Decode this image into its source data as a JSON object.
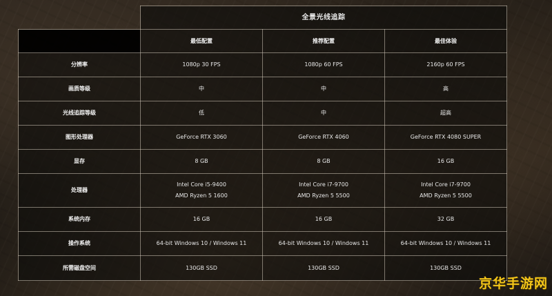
{
  "title": "全景光线追踪",
  "columns": [
    "最低配置",
    "推荐配置",
    "最佳体验"
  ],
  "rows": [
    {
      "label": "分辨率",
      "values": [
        "1080p 30 FPS",
        "1080p 60 FPS",
        "2160p 60 FPS"
      ]
    },
    {
      "label": "画质等级",
      "values": [
        "中",
        "中",
        "高"
      ]
    },
    {
      "label": "光线追踪等级",
      "values": [
        "低",
        "中",
        "超高"
      ]
    },
    {
      "label": "图形处理器",
      "values": [
        "GeForce RTX 3060",
        "GeForce RTX 4060",
        "GeForce RTX 4080 SUPER"
      ]
    },
    {
      "label": "显存",
      "values": [
        "8 GB",
        "8 GB",
        "16 GB"
      ]
    },
    {
      "label": "处理器",
      "values": [
        [
          "Intel Core i5-9400",
          "AMD Ryzen 5 1600"
        ],
        [
          "Intel Core i7-9700",
          "AMD Ryzen 5 5500"
        ],
        [
          "Intel Core i7-9700",
          "AMD Ryzen 5 5500"
        ]
      ]
    },
    {
      "label": "系统内存",
      "values": [
        "16 GB",
        "16 GB",
        "32 GB"
      ]
    },
    {
      "label": "操作系统",
      "values": [
        "64-bit Windows 10 / Windows 11",
        "64-bit Windows 10 / Windows 11",
        "64-bit Windows 10 / Windows 11"
      ]
    },
    {
      "label": "所需磁盘空间",
      "values": [
        "130GB SSD",
        "130GB SSD",
        "130GB SSD"
      ]
    }
  ],
  "watermark": "京华手游网",
  "colors": {
    "watermark": "#f3c51a",
    "border": "#d2c8b9",
    "cell_bg": "#0c0b0a"
  }
}
